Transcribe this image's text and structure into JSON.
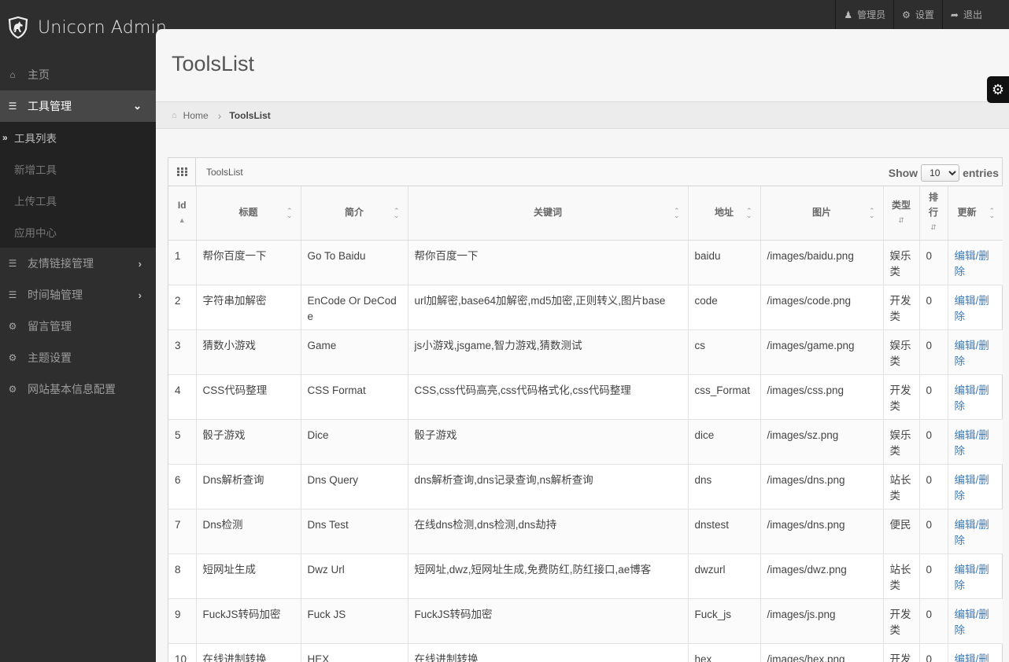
{
  "brand": {
    "name": "Unicorn Admin",
    "logo_icon": "unicorn-shield-icon"
  },
  "user_nav": [
    {
      "label": "管理员",
      "icon": "user-icon"
    },
    {
      "label": "设置",
      "icon": "gear-icon"
    },
    {
      "label": "退出",
      "icon": "share-icon"
    }
  ],
  "sidebar": {
    "items": [
      {
        "label": "主页",
        "icon": "home-icon"
      },
      {
        "label": "工具管理",
        "icon": "list-icon",
        "expanded": true,
        "children": [
          {
            "label": "工具列表",
            "active": true
          },
          {
            "label": "新增工具"
          },
          {
            "label": "上传工具"
          },
          {
            "label": "应用中心"
          }
        ]
      },
      {
        "label": "友情链接管理",
        "icon": "list-icon"
      },
      {
        "label": "时间轴管理",
        "icon": "list-icon"
      },
      {
        "label": "留言管理",
        "icon": "gear-icon"
      },
      {
        "label": "主题设置",
        "icon": "gear-icon"
      },
      {
        "label": "网站基本信息配置",
        "icon": "gear-icon"
      }
    ]
  },
  "page": {
    "title": "ToolsList"
  },
  "breadcrumb": {
    "home": "Home",
    "current": "ToolsList"
  },
  "widget": {
    "title": "ToolsList",
    "length": {
      "show": "Show",
      "value": "10",
      "entries": "entries"
    }
  },
  "table": {
    "columns": [
      "Id",
      "标题",
      "简介",
      "关键词",
      "地址",
      "图片",
      "类型",
      "排行",
      "更新"
    ],
    "rows": [
      {
        "id": "1",
        "title": "帮你百度一下",
        "desc": "Go To Baidu",
        "keywords": "帮你百度一下",
        "addr": "baidu",
        "img": "/images/baidu.png",
        "type": "娱乐类",
        "rank": "0",
        "action": "编辑/删除"
      },
      {
        "id": "2",
        "title": "字符串加解密",
        "desc": "EnCode Or DeCode",
        "keywords": "url加解密,base64加解密,md5加密,正则转义,图片base",
        "addr": "code",
        "img": "/images/code.png",
        "type": "开发类",
        "rank": "0",
        "action": "编辑/删除"
      },
      {
        "id": "3",
        "title": "猜数小游戏",
        "desc": "Game",
        "keywords": "js小游戏,jsgame,智力游戏,猜数测试",
        "addr": "cs",
        "img": "/images/game.png",
        "type": "娱乐类",
        "rank": "0",
        "action": "编辑/删除"
      },
      {
        "id": "4",
        "title": "CSS代码整理",
        "desc": "CSS Format",
        "keywords": "CSS,css代码高亮,css代码格式化,css代码整理",
        "addr": "css_Format",
        "img": "/images/css.png",
        "type": "开发类",
        "rank": "0",
        "action": "编辑/删除"
      },
      {
        "id": "5",
        "title": "骰子游戏",
        "desc": "Dice",
        "keywords": "骰子游戏",
        "addr": "dice",
        "img": "/images/sz.png",
        "type": "娱乐类",
        "rank": "0",
        "action": "编辑/删除"
      },
      {
        "id": "6",
        "title": "Dns解析查询",
        "desc": "Dns Query",
        "keywords": "dns解析查询,dns记录查询,ns解析查询",
        "addr": "dns",
        "img": "/images/dns.png",
        "type": "站长类",
        "rank": "0",
        "action": "编辑/删除"
      },
      {
        "id": "7",
        "title": "Dns检测",
        "desc": "Dns Test",
        "keywords": "在线dns检测,dns检测,dns劫持",
        "addr": "dnstest",
        "img": "/images/dns.png",
        "type": "便民",
        "rank": "0",
        "action": "编辑/删除"
      },
      {
        "id": "8",
        "title": "短网址生成",
        "desc": "Dwz Url",
        "keywords": "短网址,dwz,短网址生成,免费防红,防红接口,ae博客",
        "addr": "dwzurl",
        "img": "/images/dwz.png",
        "type": "站长类",
        "rank": "0",
        "action": "编辑/删除"
      },
      {
        "id": "9",
        "title": "FuckJS转码加密",
        "desc": "Fuck JS",
        "keywords": "FuckJS转码加密",
        "addr": "Fuck_js",
        "img": "/images/js.png",
        "type": "开发类",
        "rank": "0",
        "action": "编辑/删除"
      },
      {
        "id": "10",
        "title": "在线进制转换",
        "desc": "HEX",
        "keywords": "在线进制转换",
        "addr": "hex",
        "img": "/images/hex.png",
        "type": "开发类",
        "rank": "0",
        "action": "编辑/删除"
      }
    ]
  }
}
